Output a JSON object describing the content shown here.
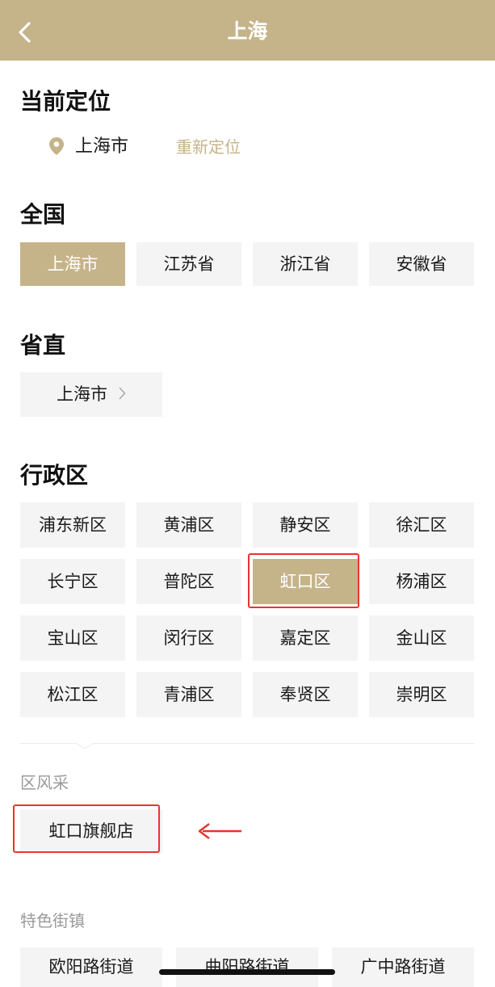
{
  "header": {
    "title": "上海"
  },
  "current_location": {
    "heading": "当前定位",
    "city": "上海市",
    "relocate_label": "重新定位"
  },
  "national": {
    "heading": "全国",
    "items": [
      "上海市",
      "江苏省",
      "浙江省",
      "安徽省"
    ],
    "selected": "上海市"
  },
  "province_direct": {
    "heading": "省直",
    "item": "上海市"
  },
  "districts": {
    "heading": "行政区",
    "items": [
      "浦东新区",
      "黄浦区",
      "静安区",
      "徐汇区",
      "长宁区",
      "普陀区",
      "虹口区",
      "杨浦区",
      "宝山区",
      "闵行区",
      "嘉定区",
      "金山区",
      "松江区",
      "青浦区",
      "奉贤区",
      "崇明区"
    ],
    "selected": "虹口区"
  },
  "district_style": {
    "heading": "区风采",
    "items": [
      "虹口旗舰店"
    ]
  },
  "featured_streets": {
    "heading": "特色街镇",
    "items": [
      "欧阳路街道",
      "曲阳路街道",
      "广中路街道"
    ]
  },
  "colors": {
    "accent": "#c5b38a",
    "highlight_red": "#e5362f",
    "button_bg": "#f4f4f4"
  },
  "icons": {
    "back": "chevron-left-icon",
    "location": "map-pin-icon",
    "more": "chevron-right-icon",
    "annotation": "arrow-left-icon"
  }
}
